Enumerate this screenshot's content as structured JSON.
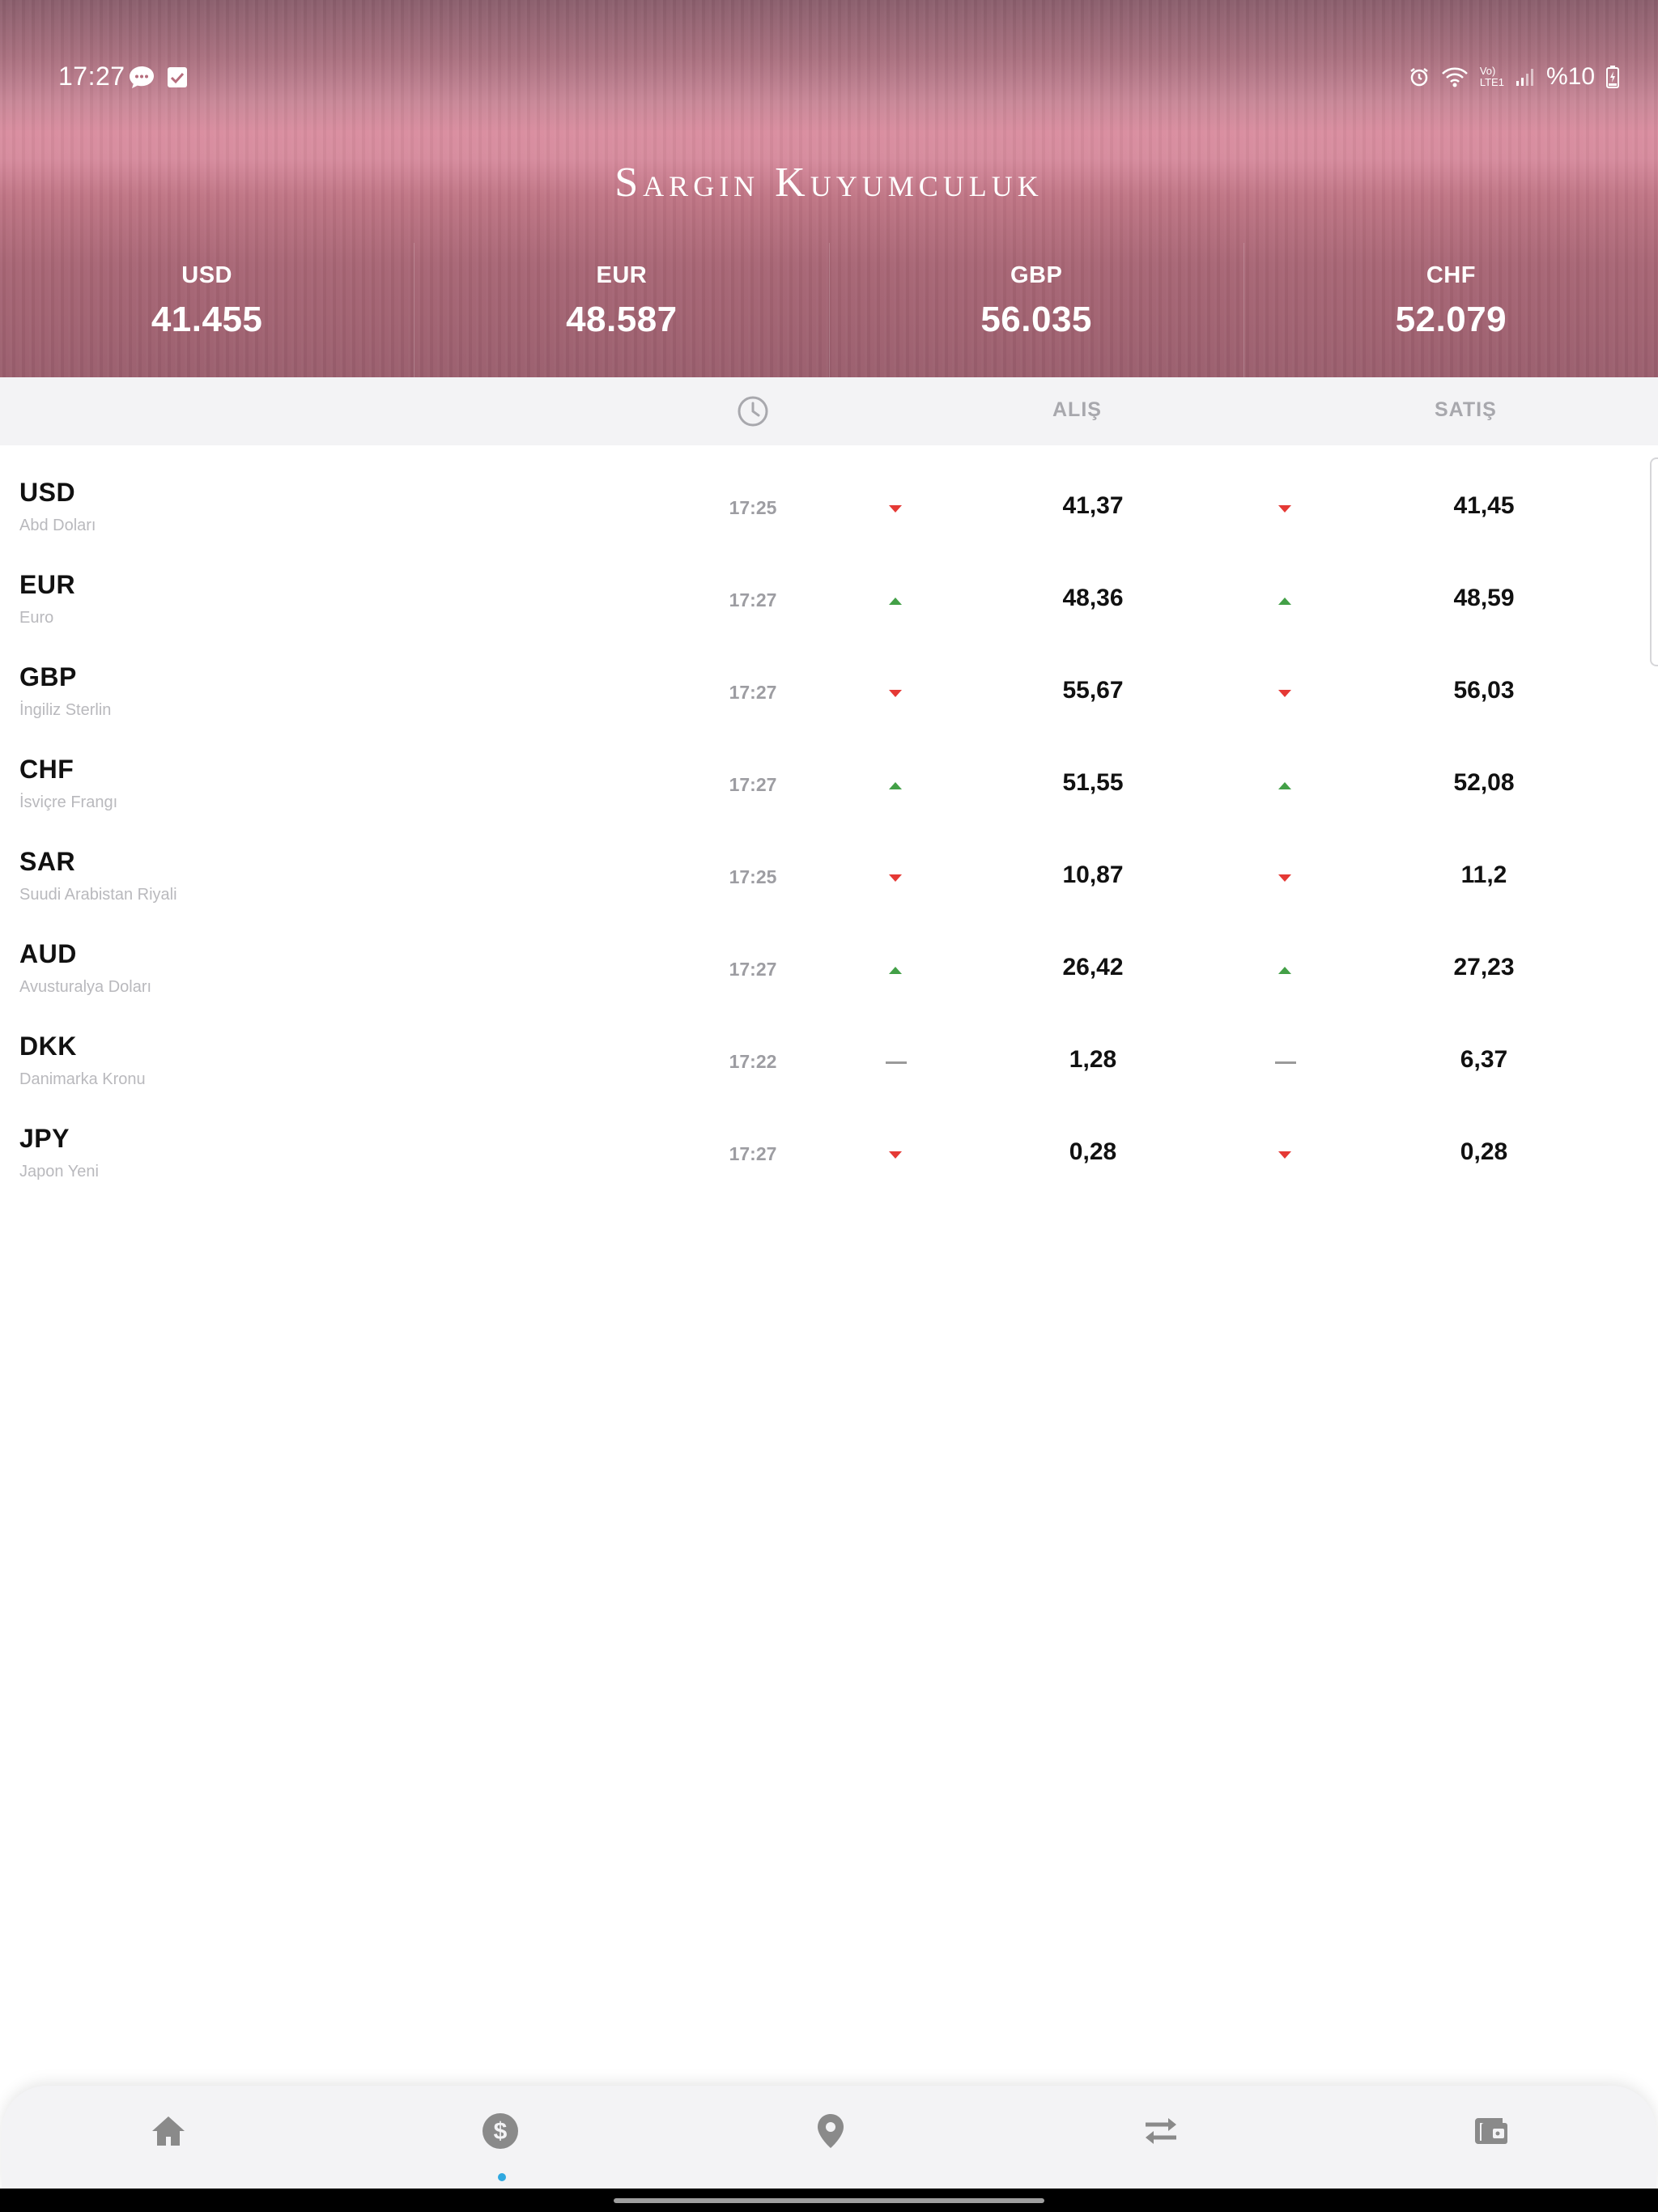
{
  "status_bar": {
    "time": "17:27",
    "battery": "%10",
    "left_icons": [
      "chat-bubble-icon",
      "check-square-icon"
    ],
    "right_icons": [
      "alarm-icon",
      "wifi-icon",
      "volte-icon",
      "signal-icon",
      "battery-charging-icon"
    ],
    "volte_label_top": "Vo)",
    "volte_label_bottom": "LTE1"
  },
  "header": {
    "brand": "Sargin Kuyumculuk",
    "rates": [
      {
        "code": "USD",
        "value": "41.455"
      },
      {
        "code": "EUR",
        "value": "48.587"
      },
      {
        "code": "GBP",
        "value": "56.035"
      },
      {
        "code": "CHF",
        "value": "52.079"
      }
    ]
  },
  "columns": {
    "time_icon": "clock-icon",
    "buy": "ALIŞ",
    "sell": "SATIŞ"
  },
  "rows": [
    {
      "code": "USD",
      "name": "Abd Doları",
      "time": "17:25",
      "buy": "41,37",
      "sell": "41,45",
      "buy_trend": "down",
      "sell_trend": "down"
    },
    {
      "code": "EUR",
      "name": "Euro",
      "time": "17:27",
      "buy": "48,36",
      "sell": "48,59",
      "buy_trend": "up",
      "sell_trend": "up"
    },
    {
      "code": "GBP",
      "name": "İngiliz Sterlin",
      "time": "17:27",
      "buy": "55,67",
      "sell": "56,03",
      "buy_trend": "down",
      "sell_trend": "down"
    },
    {
      "code": "CHF",
      "name": "İsviçre Frangı",
      "time": "17:27",
      "buy": "51,55",
      "sell": "52,08",
      "buy_trend": "up",
      "sell_trend": "up"
    },
    {
      "code": "SAR",
      "name": "Suudi Arabistan Riyali",
      "time": "17:25",
      "buy": "10,87",
      "sell": "11,2",
      "buy_trend": "down",
      "sell_trend": "down"
    },
    {
      "code": "AUD",
      "name": "Avusturalya Doları",
      "time": "17:27",
      "buy": "26,42",
      "sell": "27,23",
      "buy_trend": "up",
      "sell_trend": "up"
    },
    {
      "code": "DKK",
      "name": "Danimarka Kronu",
      "time": "17:22",
      "buy": "1,28",
      "sell": "6,37",
      "buy_trend": "flat",
      "sell_trend": "flat"
    },
    {
      "code": "JPY",
      "name": "Japon Yeni",
      "time": "17:27",
      "buy": "0,28",
      "sell": "0,28",
      "buy_trend": "down",
      "sell_trend": "down"
    }
  ],
  "bottom_nav": {
    "items": [
      "home-icon",
      "dollar-circle-icon",
      "location-pin-icon",
      "exchange-arrows-icon",
      "wallet-icon"
    ],
    "active_index": 1
  },
  "colors": {
    "header_pink": "#d98d9f",
    "header_dark": "#8a5e6c",
    "up": "#43a047",
    "down": "#e53935",
    "flat": "#9a9a9a",
    "active_dot": "#2fa8e0",
    "nav_icon": "#8a8a8a"
  }
}
